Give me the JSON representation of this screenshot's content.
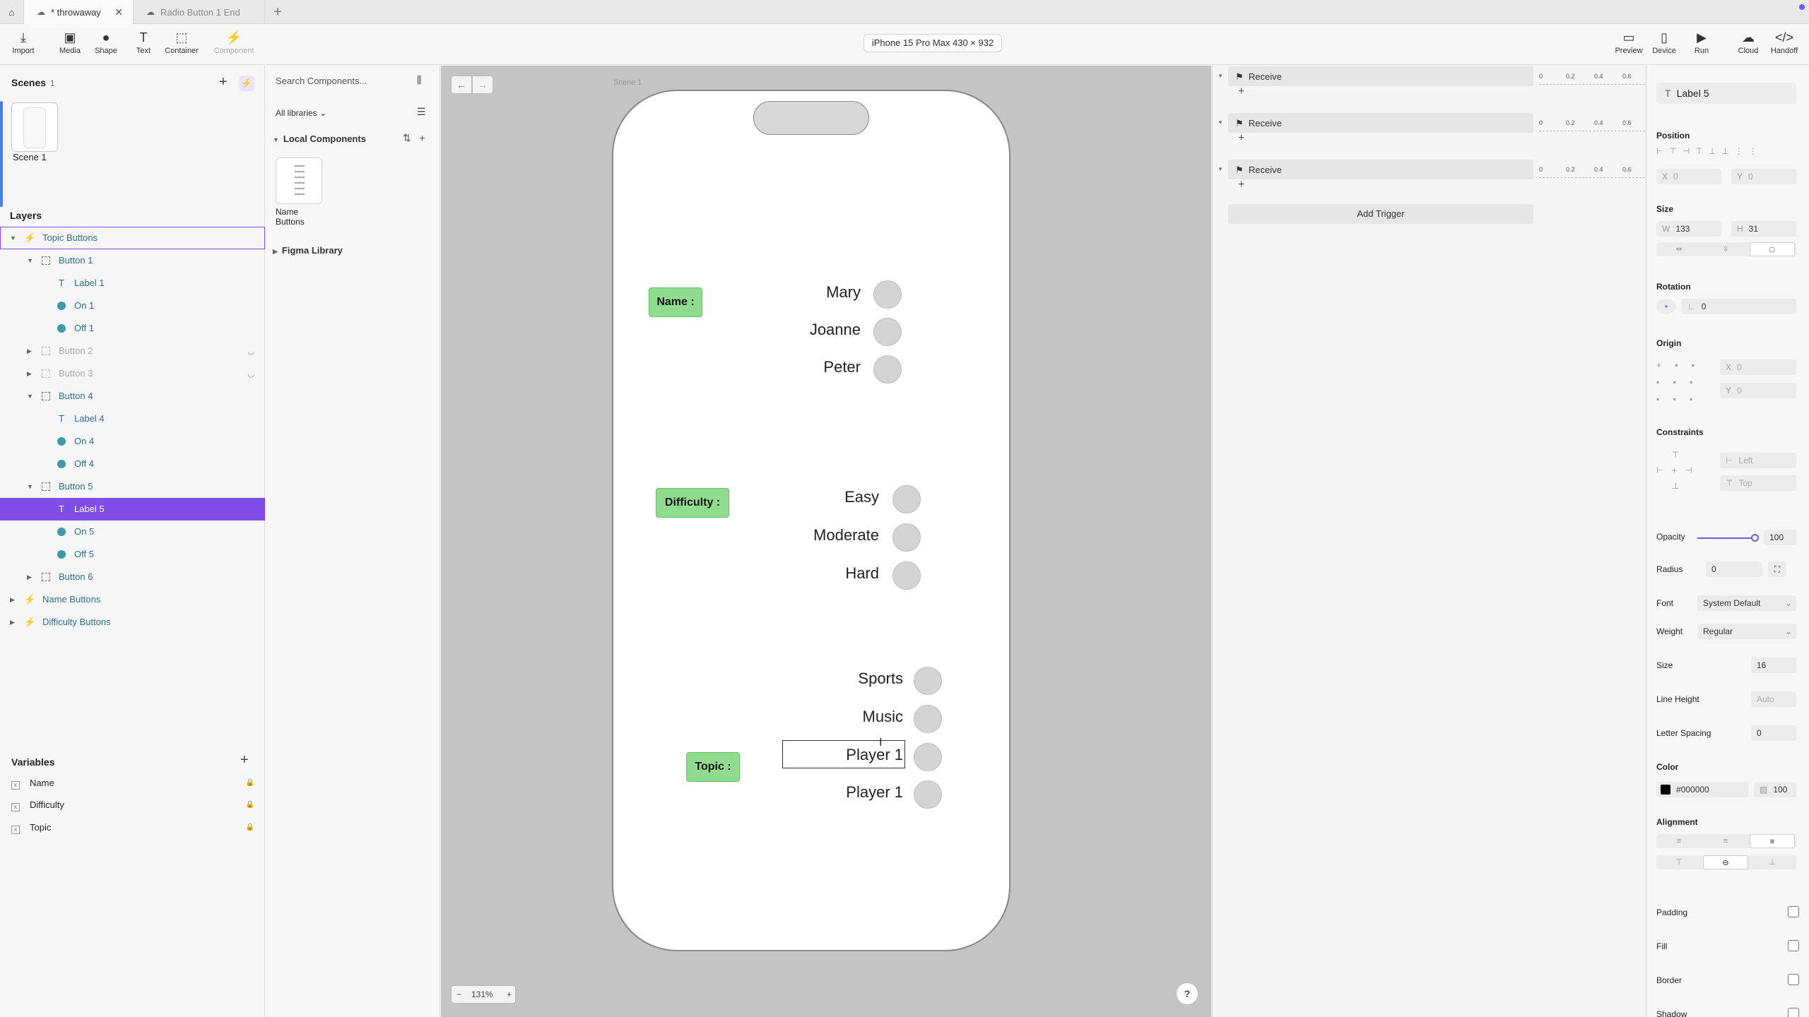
{
  "tabs": {
    "active": "* throwaway",
    "other": "Radio Button 1 End"
  },
  "toolbar": {
    "import": "Import",
    "media": "Media",
    "shape": "Shape",
    "text": "Text",
    "container": "Container",
    "component": "Component",
    "device": "iPhone 15 Pro Max  430 × 932",
    "preview": "Preview",
    "device_btn": "Device",
    "run": "Run",
    "cloud": "Cloud",
    "handoff": "Handoff"
  },
  "scenes": {
    "title": "Scenes",
    "count": "1",
    "items": [
      {
        "label": "Scene 1"
      }
    ]
  },
  "layers": {
    "title": "Layers",
    "items": [
      {
        "label": "Topic Buttons"
      },
      {
        "label": "Button 1"
      },
      {
        "label": "Label 1"
      },
      {
        "label": "On 1"
      },
      {
        "label": "Off 1"
      },
      {
        "label": "Button 2"
      },
      {
        "label": "Button 3"
      },
      {
        "label": "Button 4"
      },
      {
        "label": "Label 4"
      },
      {
        "label": "On 4"
      },
      {
        "label": "Off 4"
      },
      {
        "label": "Button 5"
      },
      {
        "label": "Label 5"
      },
      {
        "label": "On 5"
      },
      {
        "label": "Off 5"
      },
      {
        "label": "Button 6"
      },
      {
        "label": "Name Buttons"
      },
      {
        "label": "Difficulty Buttons"
      }
    ]
  },
  "variables": {
    "title": "Variables",
    "items": [
      {
        "label": "Name"
      },
      {
        "label": "Difficulty"
      },
      {
        "label": "Topic"
      }
    ]
  },
  "components": {
    "search_placeholder": "Search Components...",
    "libraries": "All libraries",
    "local_title": "Local Components",
    "item_label": "Name Buttons",
    "figma_library": "Figma Library"
  },
  "canvas": {
    "scene_caption": "Scene 1",
    "zoom": "131%",
    "help": "?",
    "labels": {
      "name": "Name :",
      "difficulty": "Difficulty :",
      "topic": "Topic :"
    },
    "name_options": [
      "Mary",
      "Joanne",
      "Peter"
    ],
    "difficulty_options": [
      "Easy",
      "Moderate",
      "Hard"
    ],
    "topic_options": [
      "Sports",
      "Music",
      "Player 1",
      "Player 1"
    ]
  },
  "timeline": {
    "triggers": [
      {
        "label": "Receive"
      },
      {
        "label": "Receive"
      },
      {
        "label": "Receive"
      }
    ],
    "ticks": [
      "0",
      "0.2",
      "0.4",
      "0.6"
    ],
    "add_trigger": "Add Trigger"
  },
  "properties": {
    "layer_name": "Label 5",
    "position_title": "Position",
    "x_label": "X",
    "x_value": "0",
    "y_label": "Y",
    "y_value": "0",
    "size_title": "Size",
    "w_label": "W",
    "w_value": "133",
    "h_label": "H",
    "h_value": "31",
    "rotation_title": "Rotation",
    "rotation_value": "0",
    "origin_title": "Origin",
    "origin_x_label": "X",
    "origin_x": "0",
    "origin_y_label": "Y",
    "origin_y": "0",
    "constraints_title": "Constraints",
    "constraint_h": "Left",
    "constraint_v": "Top",
    "opacity_label": "Opacity",
    "opacity_value": "100",
    "opacity_level": 1.0,
    "radius_label": "Radius",
    "radius_value": "0",
    "font_label": "Font",
    "font_value": "System Default",
    "weight_label": "Weight",
    "weight_value": "Regular",
    "size_label": "Size",
    "size_value": "16",
    "line_height_label": "Line Height",
    "line_height_value": "Auto",
    "letter_spacing_label": "Letter Spacing",
    "letter_spacing_value": "0",
    "color_title": "Color",
    "color_value": "#000000",
    "color_opacity": "100",
    "alignment_title": "Alignment",
    "padding_label": "Padding",
    "fill_label": "Fill",
    "border_label": "Border",
    "shadow_label": "Shadow"
  },
  "colors": {
    "accent": "#7F4EE6",
    "label_green": "#8FDC8F",
    "canvas_bg": "#C4C4C4",
    "color_swatch": "#000000"
  }
}
